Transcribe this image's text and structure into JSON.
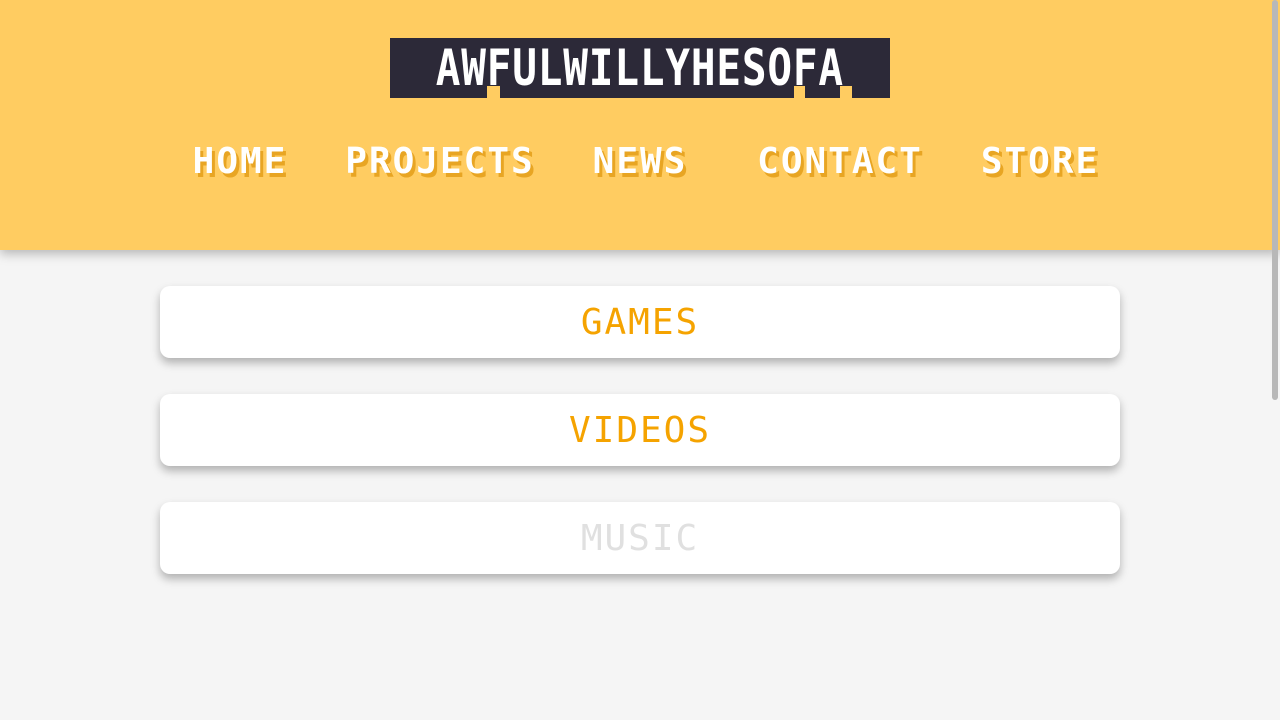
{
  "site": {
    "logo_text": "AWFULWILLYHESOFA"
  },
  "nav": {
    "items": [
      {
        "label": "HOME"
      },
      {
        "label": "PROJECTS"
      },
      {
        "label": "NEWS"
      },
      {
        "label": "CONTACT"
      },
      {
        "label": "STORE"
      }
    ]
  },
  "sections": [
    {
      "label": "GAMES",
      "enabled": true
    },
    {
      "label": "VIDEOS",
      "enabled": true
    },
    {
      "label": "MUSIC",
      "enabled": false
    }
  ],
  "colors": {
    "header_bg": "#ffcc61",
    "logo_bg": "#2c2938",
    "nav_shadow": "#e8a523",
    "accent": "#f5a300",
    "disabled": "#e0e0e0",
    "page_bg": "#f5f5f5"
  }
}
